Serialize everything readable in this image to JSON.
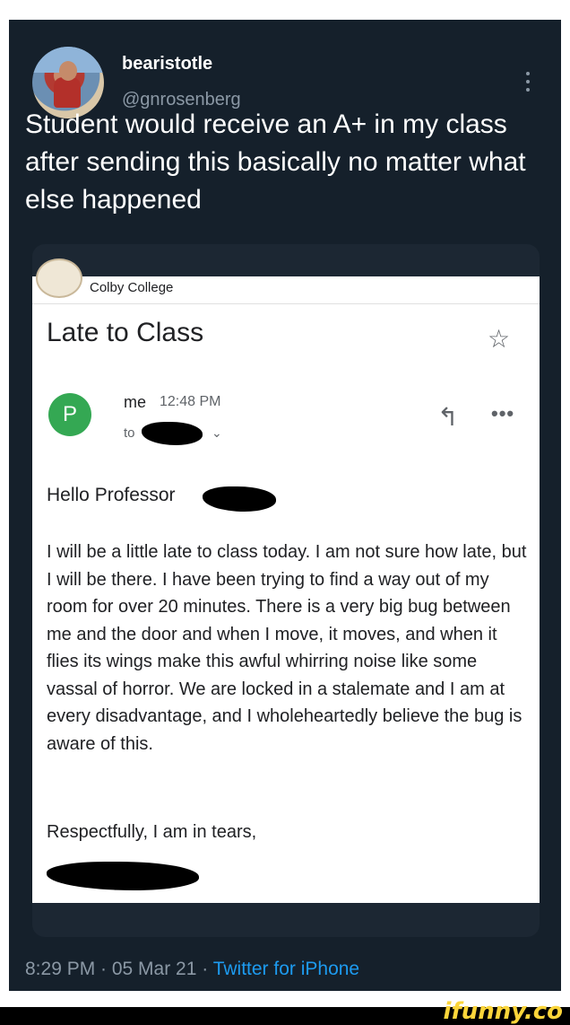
{
  "tweet": {
    "display_name": "bearistotle",
    "handle": "@gnrosenberg",
    "text": "Student would receive an A+ in my class after sending this basically no matter what else happened",
    "timestamp": "8:29 PM · 05 Mar 21 · ",
    "source": "Twitter for iPhone"
  },
  "email": {
    "org": "Colby College",
    "subject": "Late to Class",
    "avatar_letter": "P",
    "sender": "me",
    "time": "12:48 PM",
    "to_label": "to",
    "greeting": "Hello Professor",
    "body": "I will be a little late to class today. I am not sure how late, but I will be there. I have been trying to find a way out of my room for over 20 minutes. There is a very big bug between me and the door and when I move, it moves, and when it flies its wings make this awful whirring noise like some vassal of horror. We are locked in a stalemate and I am at every disadvantage, and I wholeheartedly believe the bug is aware of this.",
    "signoff": "Respectfully, I am in tears,",
    "avatar_color": "#34a853"
  },
  "icons": {
    "more": "more-vertical-icon",
    "star": "star-icon",
    "reply": "reply-icon",
    "overflow": "more-horizontal-icon"
  },
  "watermark": "ifunny.co",
  "colors": {
    "tweet_bg": "#15202b",
    "link": "#1d9bf0",
    "brand": "#fbd53a"
  }
}
